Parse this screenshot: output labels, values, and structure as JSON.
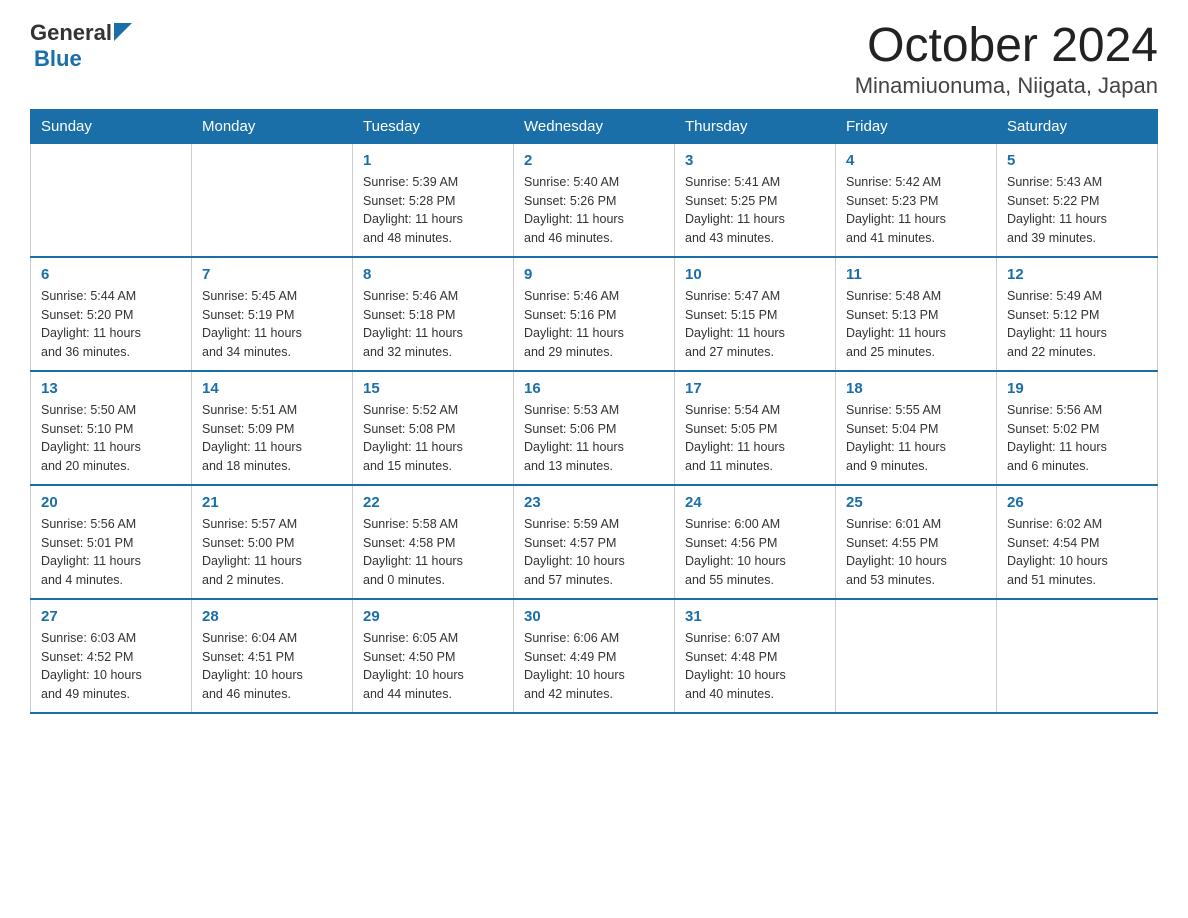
{
  "header": {
    "logo_general": "General",
    "logo_blue": "Blue",
    "title": "October 2024",
    "location": "Minamiuonuma, Niigata, Japan"
  },
  "weekdays": [
    "Sunday",
    "Monday",
    "Tuesday",
    "Wednesday",
    "Thursday",
    "Friday",
    "Saturday"
  ],
  "weeks": [
    [
      {
        "day": "",
        "info": ""
      },
      {
        "day": "",
        "info": ""
      },
      {
        "day": "1",
        "info": "Sunrise: 5:39 AM\nSunset: 5:28 PM\nDaylight: 11 hours\nand 48 minutes."
      },
      {
        "day": "2",
        "info": "Sunrise: 5:40 AM\nSunset: 5:26 PM\nDaylight: 11 hours\nand 46 minutes."
      },
      {
        "day": "3",
        "info": "Sunrise: 5:41 AM\nSunset: 5:25 PM\nDaylight: 11 hours\nand 43 minutes."
      },
      {
        "day": "4",
        "info": "Sunrise: 5:42 AM\nSunset: 5:23 PM\nDaylight: 11 hours\nand 41 minutes."
      },
      {
        "day": "5",
        "info": "Sunrise: 5:43 AM\nSunset: 5:22 PM\nDaylight: 11 hours\nand 39 minutes."
      }
    ],
    [
      {
        "day": "6",
        "info": "Sunrise: 5:44 AM\nSunset: 5:20 PM\nDaylight: 11 hours\nand 36 minutes."
      },
      {
        "day": "7",
        "info": "Sunrise: 5:45 AM\nSunset: 5:19 PM\nDaylight: 11 hours\nand 34 minutes."
      },
      {
        "day": "8",
        "info": "Sunrise: 5:46 AM\nSunset: 5:18 PM\nDaylight: 11 hours\nand 32 minutes."
      },
      {
        "day": "9",
        "info": "Sunrise: 5:46 AM\nSunset: 5:16 PM\nDaylight: 11 hours\nand 29 minutes."
      },
      {
        "day": "10",
        "info": "Sunrise: 5:47 AM\nSunset: 5:15 PM\nDaylight: 11 hours\nand 27 minutes."
      },
      {
        "day": "11",
        "info": "Sunrise: 5:48 AM\nSunset: 5:13 PM\nDaylight: 11 hours\nand 25 minutes."
      },
      {
        "day": "12",
        "info": "Sunrise: 5:49 AM\nSunset: 5:12 PM\nDaylight: 11 hours\nand 22 minutes."
      }
    ],
    [
      {
        "day": "13",
        "info": "Sunrise: 5:50 AM\nSunset: 5:10 PM\nDaylight: 11 hours\nand 20 minutes."
      },
      {
        "day": "14",
        "info": "Sunrise: 5:51 AM\nSunset: 5:09 PM\nDaylight: 11 hours\nand 18 minutes."
      },
      {
        "day": "15",
        "info": "Sunrise: 5:52 AM\nSunset: 5:08 PM\nDaylight: 11 hours\nand 15 minutes."
      },
      {
        "day": "16",
        "info": "Sunrise: 5:53 AM\nSunset: 5:06 PM\nDaylight: 11 hours\nand 13 minutes."
      },
      {
        "day": "17",
        "info": "Sunrise: 5:54 AM\nSunset: 5:05 PM\nDaylight: 11 hours\nand 11 minutes."
      },
      {
        "day": "18",
        "info": "Sunrise: 5:55 AM\nSunset: 5:04 PM\nDaylight: 11 hours\nand 9 minutes."
      },
      {
        "day": "19",
        "info": "Sunrise: 5:56 AM\nSunset: 5:02 PM\nDaylight: 11 hours\nand 6 minutes."
      }
    ],
    [
      {
        "day": "20",
        "info": "Sunrise: 5:56 AM\nSunset: 5:01 PM\nDaylight: 11 hours\nand 4 minutes."
      },
      {
        "day": "21",
        "info": "Sunrise: 5:57 AM\nSunset: 5:00 PM\nDaylight: 11 hours\nand 2 minutes."
      },
      {
        "day": "22",
        "info": "Sunrise: 5:58 AM\nSunset: 4:58 PM\nDaylight: 11 hours\nand 0 minutes."
      },
      {
        "day": "23",
        "info": "Sunrise: 5:59 AM\nSunset: 4:57 PM\nDaylight: 10 hours\nand 57 minutes."
      },
      {
        "day": "24",
        "info": "Sunrise: 6:00 AM\nSunset: 4:56 PM\nDaylight: 10 hours\nand 55 minutes."
      },
      {
        "day": "25",
        "info": "Sunrise: 6:01 AM\nSunset: 4:55 PM\nDaylight: 10 hours\nand 53 minutes."
      },
      {
        "day": "26",
        "info": "Sunrise: 6:02 AM\nSunset: 4:54 PM\nDaylight: 10 hours\nand 51 minutes."
      }
    ],
    [
      {
        "day": "27",
        "info": "Sunrise: 6:03 AM\nSunset: 4:52 PM\nDaylight: 10 hours\nand 49 minutes."
      },
      {
        "day": "28",
        "info": "Sunrise: 6:04 AM\nSunset: 4:51 PM\nDaylight: 10 hours\nand 46 minutes."
      },
      {
        "day": "29",
        "info": "Sunrise: 6:05 AM\nSunset: 4:50 PM\nDaylight: 10 hours\nand 44 minutes."
      },
      {
        "day": "30",
        "info": "Sunrise: 6:06 AM\nSunset: 4:49 PM\nDaylight: 10 hours\nand 42 minutes."
      },
      {
        "day": "31",
        "info": "Sunrise: 6:07 AM\nSunset: 4:48 PM\nDaylight: 10 hours\nand 40 minutes."
      },
      {
        "day": "",
        "info": ""
      },
      {
        "day": "",
        "info": ""
      }
    ]
  ]
}
